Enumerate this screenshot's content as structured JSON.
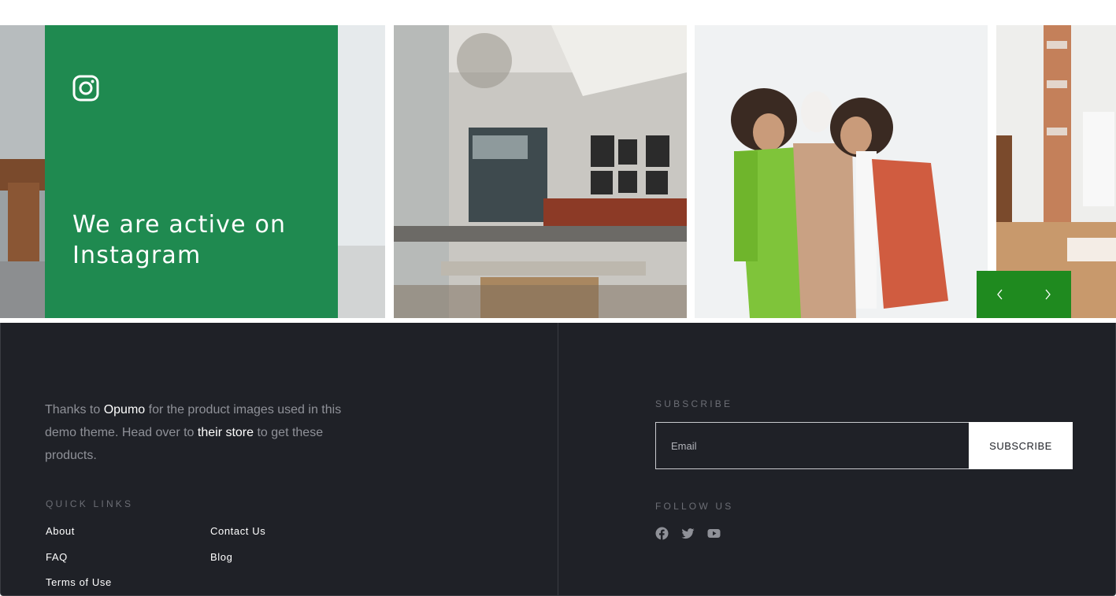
{
  "promo": {
    "headline": "We are active on Instagram",
    "icon": "instagram-icon",
    "background": "#1f8a50"
  },
  "slider": {
    "prev_icon": "chevron-left-icon",
    "next_icon": "chevron-right-icon",
    "background": "#1f8a1f"
  },
  "footer": {
    "credits": {
      "text_1": "Thanks to ",
      "link_1": "Opumo",
      "text_2": " for the product images used in this demo theme. Head over to ",
      "link_2": "their store",
      "text_3": " to get these products."
    },
    "quick_links": {
      "label": "QUICK LINKS",
      "items": [
        "About",
        "Contact Us",
        "FAQ",
        "Blog",
        "Terms of Use"
      ]
    },
    "subscribe": {
      "label": "SUBSCRIBE",
      "placeholder": "Email",
      "button": "SUBSCRIBE"
    },
    "follow": {
      "label": "FOLLOW US",
      "icons": [
        "facebook-icon",
        "twitter-icon",
        "youtube-icon"
      ]
    },
    "background": "#1f2127"
  }
}
